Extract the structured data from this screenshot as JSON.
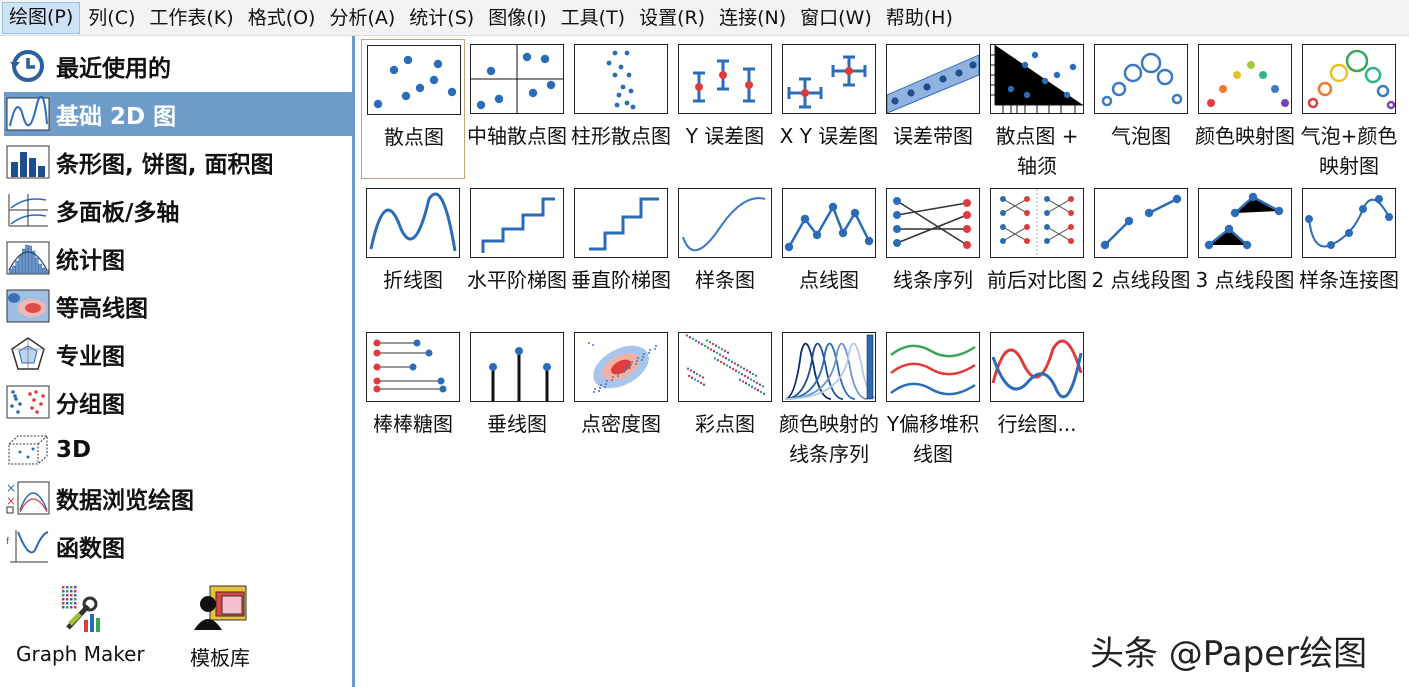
{
  "menubar": {
    "items": [
      "绘图(P)",
      "列(C)",
      "工作表(K)",
      "格式(O)",
      "分析(A)",
      "统计(S)",
      "图像(I)",
      "工具(T)",
      "设置(R)",
      "连接(N)",
      "窗口(W)",
      "帮助(H)"
    ]
  },
  "sidebar": {
    "items": [
      {
        "label": "最近使用的",
        "icon": "recent-icon"
      },
      {
        "label": "基础 2D 图",
        "icon": "basic-2d-icon",
        "selected": true
      },
      {
        "label": "条形图, 饼图, 面积图",
        "icon": "bar-chart-icon"
      },
      {
        "label": "多面板/多轴",
        "icon": "multi-panel-icon"
      },
      {
        "label": "统计图",
        "icon": "histogram-icon"
      },
      {
        "label": "等高线图",
        "icon": "contour-icon"
      },
      {
        "label": "专业图",
        "icon": "radar-icon"
      },
      {
        "label": "分组图",
        "icon": "grouped-scatter-icon"
      },
      {
        "label": "3D",
        "icon": "3d-box-icon"
      },
      {
        "label": "数据浏览绘图",
        "icon": "data-explore-icon"
      },
      {
        "label": "函数图",
        "icon": "function-icon"
      }
    ],
    "tools": [
      {
        "label": "Graph Maker",
        "icon": "graph-maker-icon"
      },
      {
        "label": "模板库",
        "icon": "template-library-icon"
      }
    ]
  },
  "tiles": [
    {
      "label": "散点图",
      "selected": true
    },
    {
      "label": "中轴散点图"
    },
    {
      "label": "柱形散点图"
    },
    {
      "label": "Y 误差图"
    },
    {
      "label": "X Y 误差图"
    },
    {
      "label": "误差带图"
    },
    {
      "label": "散点图 + 轴须"
    },
    {
      "label": "气泡图"
    },
    {
      "label": "颜色映射图"
    },
    {
      "label": "气泡+颜色映射图"
    },
    {
      "label": "折线图"
    },
    {
      "label": "水平阶梯图"
    },
    {
      "label": "垂直阶梯图"
    },
    {
      "label": "样条图"
    },
    {
      "label": "点线图"
    },
    {
      "label": "线条序列"
    },
    {
      "label": "前后对比图"
    },
    {
      "label": "2 点线段图"
    },
    {
      "label": "3 点线段图"
    },
    {
      "label": "样条连接图"
    },
    {
      "label": "棒棒糖图"
    },
    {
      "label": "垂线图"
    },
    {
      "label": "点密度图"
    },
    {
      "label": "彩点图"
    },
    {
      "label": "颜色映射的线条序列"
    },
    {
      "label": "Y偏移堆积线图"
    },
    {
      "label": "行绘图..."
    }
  ],
  "watermark": "头条 @Paper绘图",
  "colors": {
    "accent": "#6d9ccb",
    "plot_blue": "#2b6cb8",
    "error_red": "#e03a3a"
  }
}
